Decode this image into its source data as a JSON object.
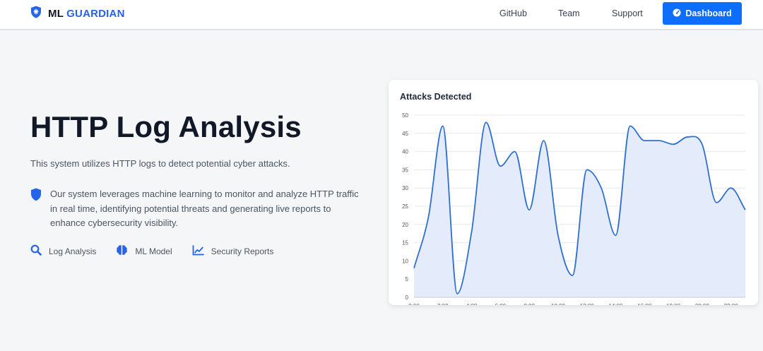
{
  "brand": {
    "prefix": "ML",
    "name": "GUARDIAN",
    "accent": "#2563eb"
  },
  "nav": {
    "links": [
      "GitHub",
      "Team",
      "Support"
    ],
    "dashboard_label": "Dashboard",
    "button_color": "#0d6efd"
  },
  "hero": {
    "title": "HTTP Log Analysis",
    "subtitle": "This system utilizes HTTP logs to detect potential cyber attacks.",
    "feature_text": "Our system leverages machine learning to monitor and analyze HTTP traffic in real time, identifying potential threats and generating live reports to enhance cybersecurity visibility.",
    "links": [
      {
        "icon": "search-icon",
        "label": "Log Analysis"
      },
      {
        "icon": "brain-icon",
        "label": "ML Model"
      },
      {
        "icon": "chart-line-icon",
        "label": "Security Reports"
      }
    ]
  },
  "chart_data": {
    "type": "area",
    "title": "Attacks Detected",
    "x": [
      "0:00",
      "1:00",
      "2:00",
      "3:00",
      "4:00",
      "5:00",
      "6:00",
      "7:00",
      "8:00",
      "9:00",
      "10:00",
      "11:00",
      "12:00",
      "13:00",
      "14:00",
      "15:00",
      "16:00",
      "17:00",
      "18:00",
      "19:00",
      "20:00",
      "21:00",
      "22:00",
      "23:00"
    ],
    "xticks": [
      "0:00",
      "2:00",
      "4:00",
      "6:00",
      "8:00",
      "10:00",
      "12:00",
      "14:00",
      "16:00",
      "18:00",
      "20:00",
      "22:00"
    ],
    "series": [
      {
        "values": [
          8,
          22,
          47,
          1,
          18,
          48,
          36,
          40,
          24,
          43,
          17,
          6,
          35,
          30,
          17,
          47,
          43,
          43,
          42,
          44,
          42,
          26,
          30,
          24
        ]
      }
    ],
    "ylim": [
      0,
      50
    ],
    "yticks": [
      0,
      5,
      10,
      15,
      20,
      25,
      30,
      35,
      40,
      45,
      50
    ],
    "grid": true,
    "line_color": "#2f6fd1",
    "fill_color": "#e4ecfb"
  }
}
